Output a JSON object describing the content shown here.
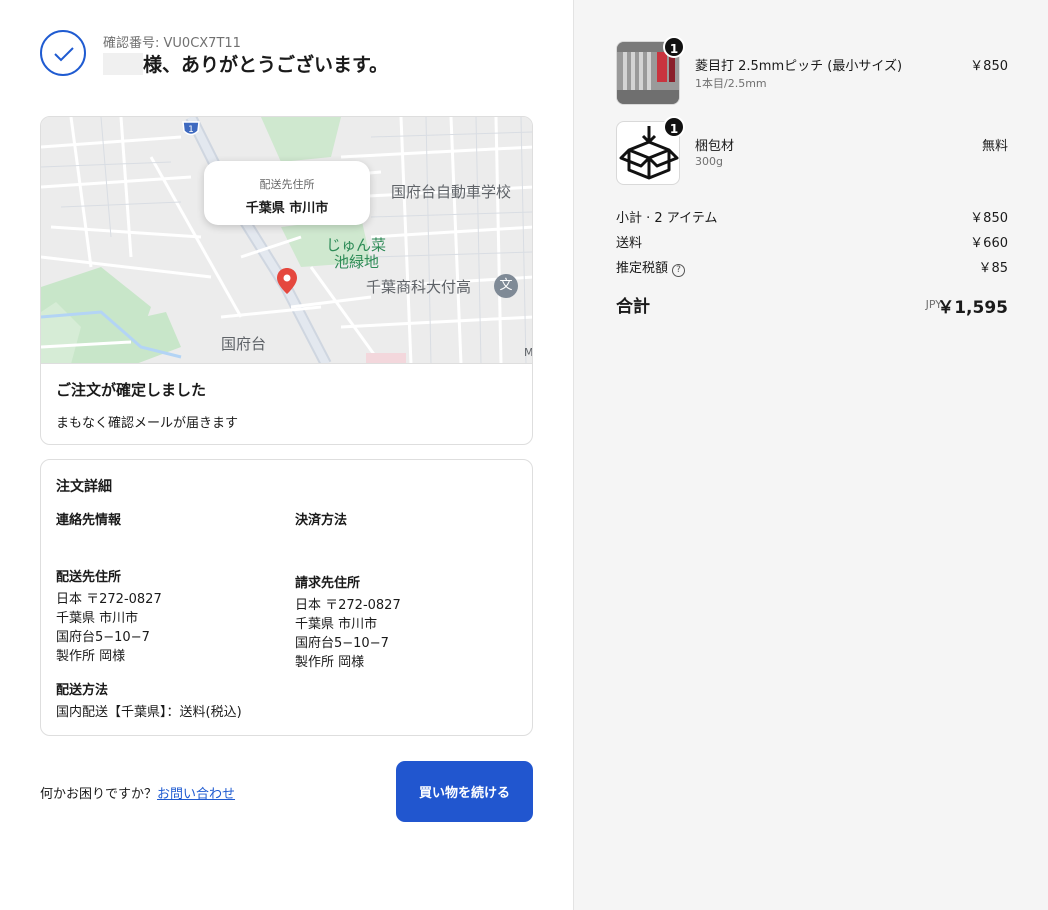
{
  "header": {
    "confirmation_number": "確認番号: VU0CX7T11",
    "thanks_message": "様、ありがとうございます。"
  },
  "map": {
    "popup_title": "配送先住所",
    "popup_value": "千葉県 市川市",
    "labels": {
      "school": "国府台自動車学校",
      "park_line1": "じゅん菜",
      "park_line2": "池緑地",
      "high_school": "千葉商科大付高",
      "district": "国府台",
      "route_number": "1",
      "corner": "M",
      "school_icon": "文"
    }
  },
  "confirmation": {
    "title": "ご注文が確定しました",
    "subtitle": "まもなく確認メールが届きます"
  },
  "details": {
    "title": "注文詳細",
    "contact_label": "連絡先情報",
    "payment_label": "決済方法",
    "shipping_address_label": "配送先住所",
    "shipping_address": [
      "日本 〒272-0827",
      "千葉県 市川市",
      "国府台5−10−7",
      "製作所 岡様"
    ],
    "billing_address_label": "請求先住所",
    "billing_address": [
      "日本 〒272-0827",
      "千葉県 市川市",
      "国府台5−10−7",
      "製作所 岡様"
    ],
    "shipping_method_label": "配送方法",
    "shipping_method": "国内配送【千葉県】：送料(税込)"
  },
  "footer": {
    "help_text": "何かお困りですか？",
    "contact_link": "お問い合わせ",
    "continue_button": "買い物を続ける"
  },
  "order_summary": {
    "items": [
      {
        "name": "菱目打 2.5mmピッチ (最小サイズ)",
        "variant": "1本目/2.5mm",
        "price": "￥850",
        "quantity": "1"
      },
      {
        "name": "梱包材",
        "variant": "300g",
        "price": "無料",
        "quantity": "1"
      }
    ],
    "subtotal_label": "小計 · 2 アイテム",
    "subtotal_value": "￥850",
    "shipping_label": "送料",
    "shipping_value": "￥660",
    "tax_label": "推定税額",
    "tax_value": "￥85",
    "total_label": "合計",
    "currency": "JPY",
    "total_value": "￥1,595"
  },
  "colors": {
    "accent": "#2156cf",
    "sidebar_bg": "#f5f5f5"
  }
}
